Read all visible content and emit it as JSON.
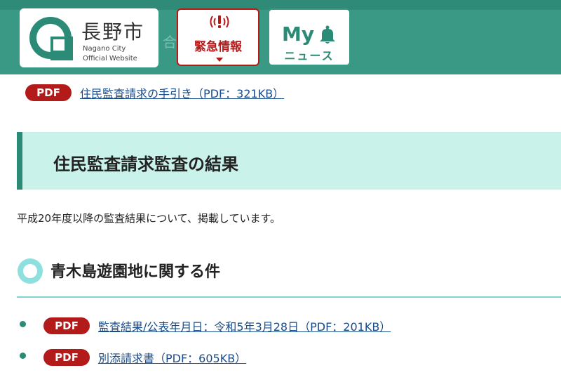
{
  "header": {
    "background_color": "#3a9985",
    "bg_text": "合 ぞ",
    "logo": {
      "name": "長野市",
      "sub1": "Nagano City",
      "sub2": "Official Website",
      "icon": "nagano-city-emblem-icon"
    },
    "emergency": {
      "label": "緊急情報",
      "icon": "alert-broadcast-icon",
      "color": "#b31b1b"
    },
    "my_news": {
      "my": "My",
      "news": "ニュース",
      "icon": "bell-icon",
      "color": "#2b8b76"
    }
  },
  "content": {
    "top_link": {
      "badge": "PDF",
      "text": "住民監査請求の手引き（PDF：321KB）"
    },
    "section_title": "住民監査請求監査の結果",
    "intro": "平成20年度以降の監査結果について、掲載しています。",
    "subsection": {
      "title": "青木島遊園地に関する件",
      "icon": "circle-ring-icon",
      "items": [
        {
          "badge": "PDF",
          "text": "監査結果/公表年月日：令和5年3月28日（PDF：201KB）"
        },
        {
          "badge": "PDF",
          "text": "別添請求書（PDF：605KB）"
        }
      ]
    }
  },
  "colors": {
    "pdf_badge": "#b31b1b",
    "link": "#1a4c8c",
    "accent": "#2b8b76",
    "section_band": "#c9f2ea"
  }
}
